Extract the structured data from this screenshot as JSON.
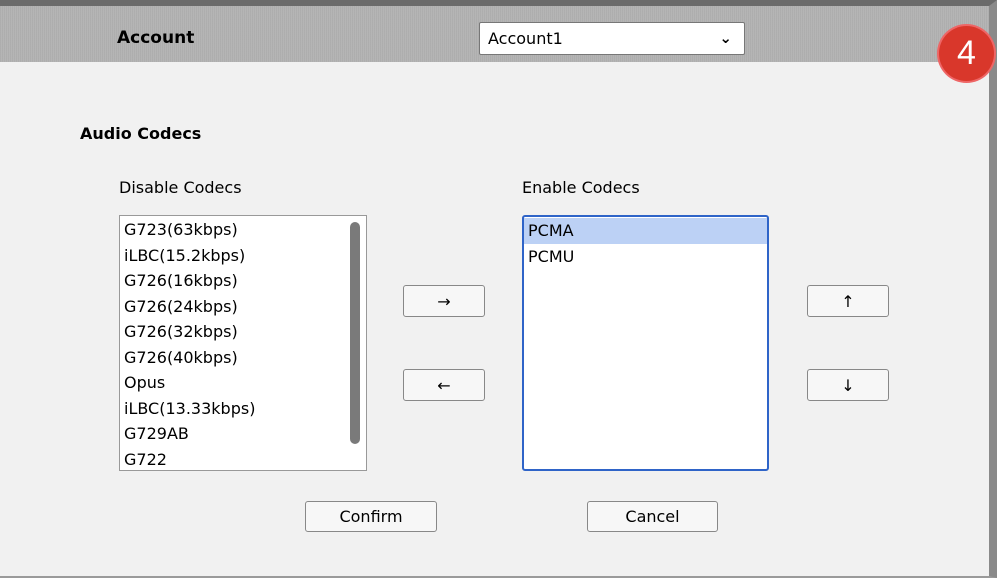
{
  "header": {
    "account_label": "Account",
    "account_select": {
      "value": "Account1",
      "chevron_icon": "chevron-down-icon"
    }
  },
  "badge": {
    "step": "4",
    "color": "#d9372b"
  },
  "section": {
    "title": "Audio Codecs"
  },
  "disabled_codecs": {
    "label": "Disable Codecs",
    "items": [
      "G723(63kbps)",
      "iLBC(15.2kbps)",
      "G726(16kbps)",
      "G726(24kbps)",
      "G726(32kbps)",
      "G726(40kbps)",
      "Opus",
      "iLBC(13.33kbps)",
      "G729AB",
      "G722"
    ]
  },
  "enabled_codecs": {
    "label": "Enable Codecs",
    "items": [
      "PCMA",
      "PCMU"
    ],
    "selected": "PCMA",
    "focus_color": "#2f64c8"
  },
  "buttons": {
    "move_right": "→",
    "move_left": "←",
    "move_up": "↑",
    "move_down": "↓",
    "confirm": "Confirm",
    "cancel": "Cancel"
  }
}
